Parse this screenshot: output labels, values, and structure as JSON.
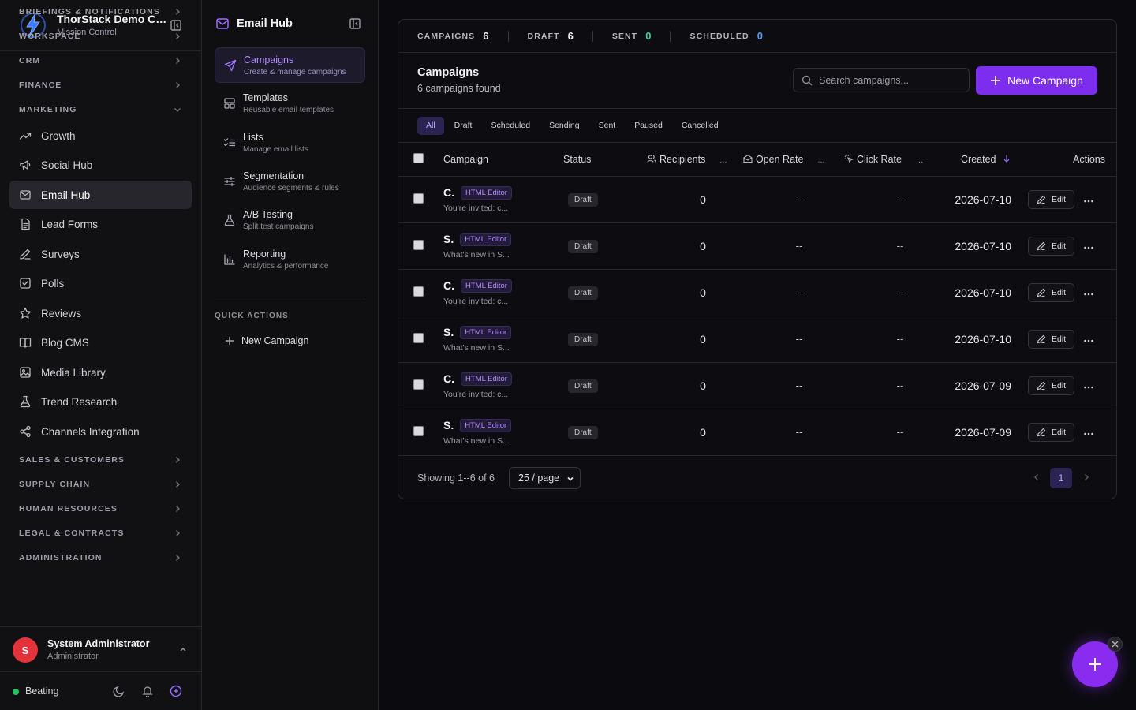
{
  "brand": {
    "title": "ThorStack Demo Company",
    "subtitle": "Mission Control"
  },
  "sidebar": {
    "sections_top": [
      {
        "label": "BRIEFINGS & NOTIFICATIONS"
      },
      {
        "label": "WORKSPACE"
      },
      {
        "label": "CRM"
      },
      {
        "label": "FINANCE"
      },
      {
        "label": "MARKETING"
      }
    ],
    "marketing_items": [
      {
        "label": "Growth",
        "icon": "trending-up-icon"
      },
      {
        "label": "Social Hub",
        "icon": "megaphone-icon"
      },
      {
        "label": "Email Hub",
        "icon": "mail-icon",
        "active": true
      },
      {
        "label": "Lead Forms",
        "icon": "file-form-icon"
      },
      {
        "label": "Surveys",
        "icon": "pen-icon"
      },
      {
        "label": "Polls",
        "icon": "checkbox-icon"
      },
      {
        "label": "Reviews",
        "icon": "star-icon"
      },
      {
        "label": "Blog CMS",
        "icon": "book-icon"
      },
      {
        "label": "Media Library",
        "icon": "image-icon"
      },
      {
        "label": "Trend Research",
        "icon": "flask-icon"
      },
      {
        "label": "Channels Integration",
        "icon": "share-icon"
      }
    ],
    "sections_bottom": [
      {
        "label": "SALES & CUSTOMERS"
      },
      {
        "label": "SUPPLY CHAIN"
      },
      {
        "label": "HUMAN RESOURCES"
      },
      {
        "label": "LEGAL & CONTRACTS"
      },
      {
        "label": "ADMINISTRATION"
      }
    ],
    "user": {
      "initial": "S",
      "name": "System Administrator",
      "role": "Administrator"
    },
    "status": {
      "text": "Beating"
    }
  },
  "subnav": {
    "title": "Email Hub",
    "items": [
      {
        "label": "Campaigns",
        "desc": "Create & manage campaigns",
        "icon": "send-icon",
        "active": true
      },
      {
        "label": "Templates",
        "desc": "Reusable email templates",
        "icon": "layout-template-icon"
      },
      {
        "label": "Lists",
        "desc": "Manage email lists",
        "icon": "list-checks-icon"
      },
      {
        "label": "Segmentation",
        "desc": "Audience segments & rules",
        "icon": "sliders-icon"
      },
      {
        "label": "A/B Testing",
        "desc": "Split test campaigns",
        "icon": "flask-icon"
      },
      {
        "label": "Reporting",
        "desc": "Analytics & performance",
        "icon": "bar-chart-icon"
      }
    ],
    "quick_actions_heading": "QUICK ACTIONS",
    "quick_actions": [
      {
        "label": "New Campaign",
        "icon": "plus-icon"
      }
    ]
  },
  "stats": [
    {
      "label": "CAMPAIGNS",
      "value": "6",
      "color": "#f2f2f5"
    },
    {
      "label": "DRAFT",
      "value": "6",
      "color": "#f2f2f5"
    },
    {
      "label": "SENT",
      "value": "0",
      "color": "#2dd4a7"
    },
    {
      "label": "SCHEDULED",
      "value": "0",
      "color": "#4f9bff"
    }
  ],
  "list": {
    "title": "Campaigns",
    "count": "6 campaigns found",
    "search_placeholder": "Search campaigns...",
    "new_button": "New Campaign"
  },
  "filters": [
    "All",
    "Draft",
    "Scheduled",
    "Sending",
    "Sent",
    "Paused",
    "Cancelled"
  ],
  "table": {
    "columns": {
      "campaign": "Campaign",
      "status": "Status",
      "recipients": "Recipients",
      "open_rate": "Open Rate",
      "click_rate": "Click Rate",
      "created": "Created",
      "actions": "Actions"
    },
    "more_marker": "...",
    "edit_label": "Edit",
    "rows": [
      {
        "letter": "C.",
        "tag": "HTML Editor",
        "sub": "You're invited: c...",
        "status": "Draft",
        "recipients": "0",
        "open": "--",
        "click": "--",
        "created": "2026-07-10"
      },
      {
        "letter": "S.",
        "tag": "HTML Editor",
        "sub": "What's new in S...",
        "status": "Draft",
        "recipients": "0",
        "open": "--",
        "click": "--",
        "created": "2026-07-10"
      },
      {
        "letter": "C.",
        "tag": "HTML Editor",
        "sub": "You're invited: c...",
        "status": "Draft",
        "recipients": "0",
        "open": "--",
        "click": "--",
        "created": "2026-07-10"
      },
      {
        "letter": "S.",
        "tag": "HTML Editor",
        "sub": "What's new in S...",
        "status": "Draft",
        "recipients": "0",
        "open": "--",
        "click": "--",
        "created": "2026-07-10"
      },
      {
        "letter": "C.",
        "tag": "HTML Editor",
        "sub": "You're invited: c...",
        "status": "Draft",
        "recipients": "0",
        "open": "--",
        "click": "--",
        "created": "2026-07-09"
      },
      {
        "letter": "S.",
        "tag": "HTML Editor",
        "sub": "What's new in S...",
        "status": "Draft",
        "recipients": "0",
        "open": "--",
        "click": "--",
        "created": "2026-07-09"
      }
    ]
  },
  "footer": {
    "showing": "Showing 1--6 of 6",
    "per_page": "25 / page",
    "page": "1"
  },
  "colors": {
    "accent": "#7c2dee",
    "success": "#22c55e",
    "danger": "#e5333b"
  }
}
